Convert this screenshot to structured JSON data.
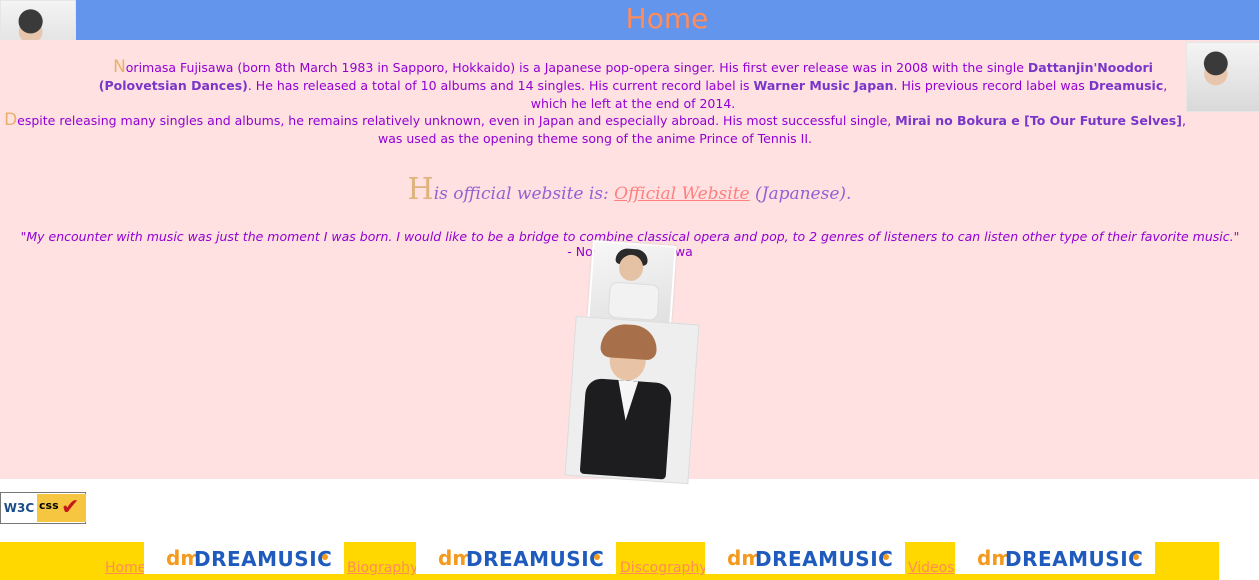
{
  "header": {
    "title": "Home"
  },
  "intro": {
    "p1_dropcap": "N",
    "p1_text_a": "orimasa Fujisawa (born 8th March 1983 in Sapporo, Hokkaido) is a Japanese pop-opera singer. His first ever release was in 2008 with the single ",
    "p1_bold_a": "Dattanjin'Noodori (Polovetsian Dances)",
    "p1_text_b": ". He has released a total of 10 albums and 14 singles. His current record label is ",
    "p1_bold_b": "Warner Music Japan",
    "p1_text_c": ". His previous record label was ",
    "p1_bold_c": "Dreamusic",
    "p1_text_d": ", which he left at the end of 2014.",
    "p2_dropcap": "D",
    "p2_text_a": "espite releasing many singles and albums, he remains relatively unknown, even in Japan and especially abroad. His most successful single, ",
    "p2_bold_a": "Mirai no Bokura e [To Our Future Selves]",
    "p2_text_b": ", was used as the opening theme song of the anime Prince of Tennis II."
  },
  "official": {
    "cap": "H",
    "text_a": "is official website is: ",
    "link": "Official Website",
    "text_b": " (Japanese)."
  },
  "quote": {
    "text": "\"My encounter with music was just the moment I was born. I would like to be a bridge to combine classical opera and pop, to 2 genres of listeners to can listen other type of their favorite music.\"",
    "author": " - Norimasa Fujisawa"
  },
  "badge": {
    "left": "W3C",
    "right": "css"
  },
  "nav": {
    "items": [
      {
        "label": "Home"
      },
      {
        "label": "Biography"
      },
      {
        "label": "Discography"
      },
      {
        "label": "Videos"
      }
    ],
    "logo_text": "DREAMUSIC",
    "logo_mark": "dm"
  },
  "colors": {
    "header": "#6495ed",
    "content": "#ffe1e1",
    "nav": "#ffd800",
    "text": "#9400d3",
    "link": "#ff8c5a"
  }
}
